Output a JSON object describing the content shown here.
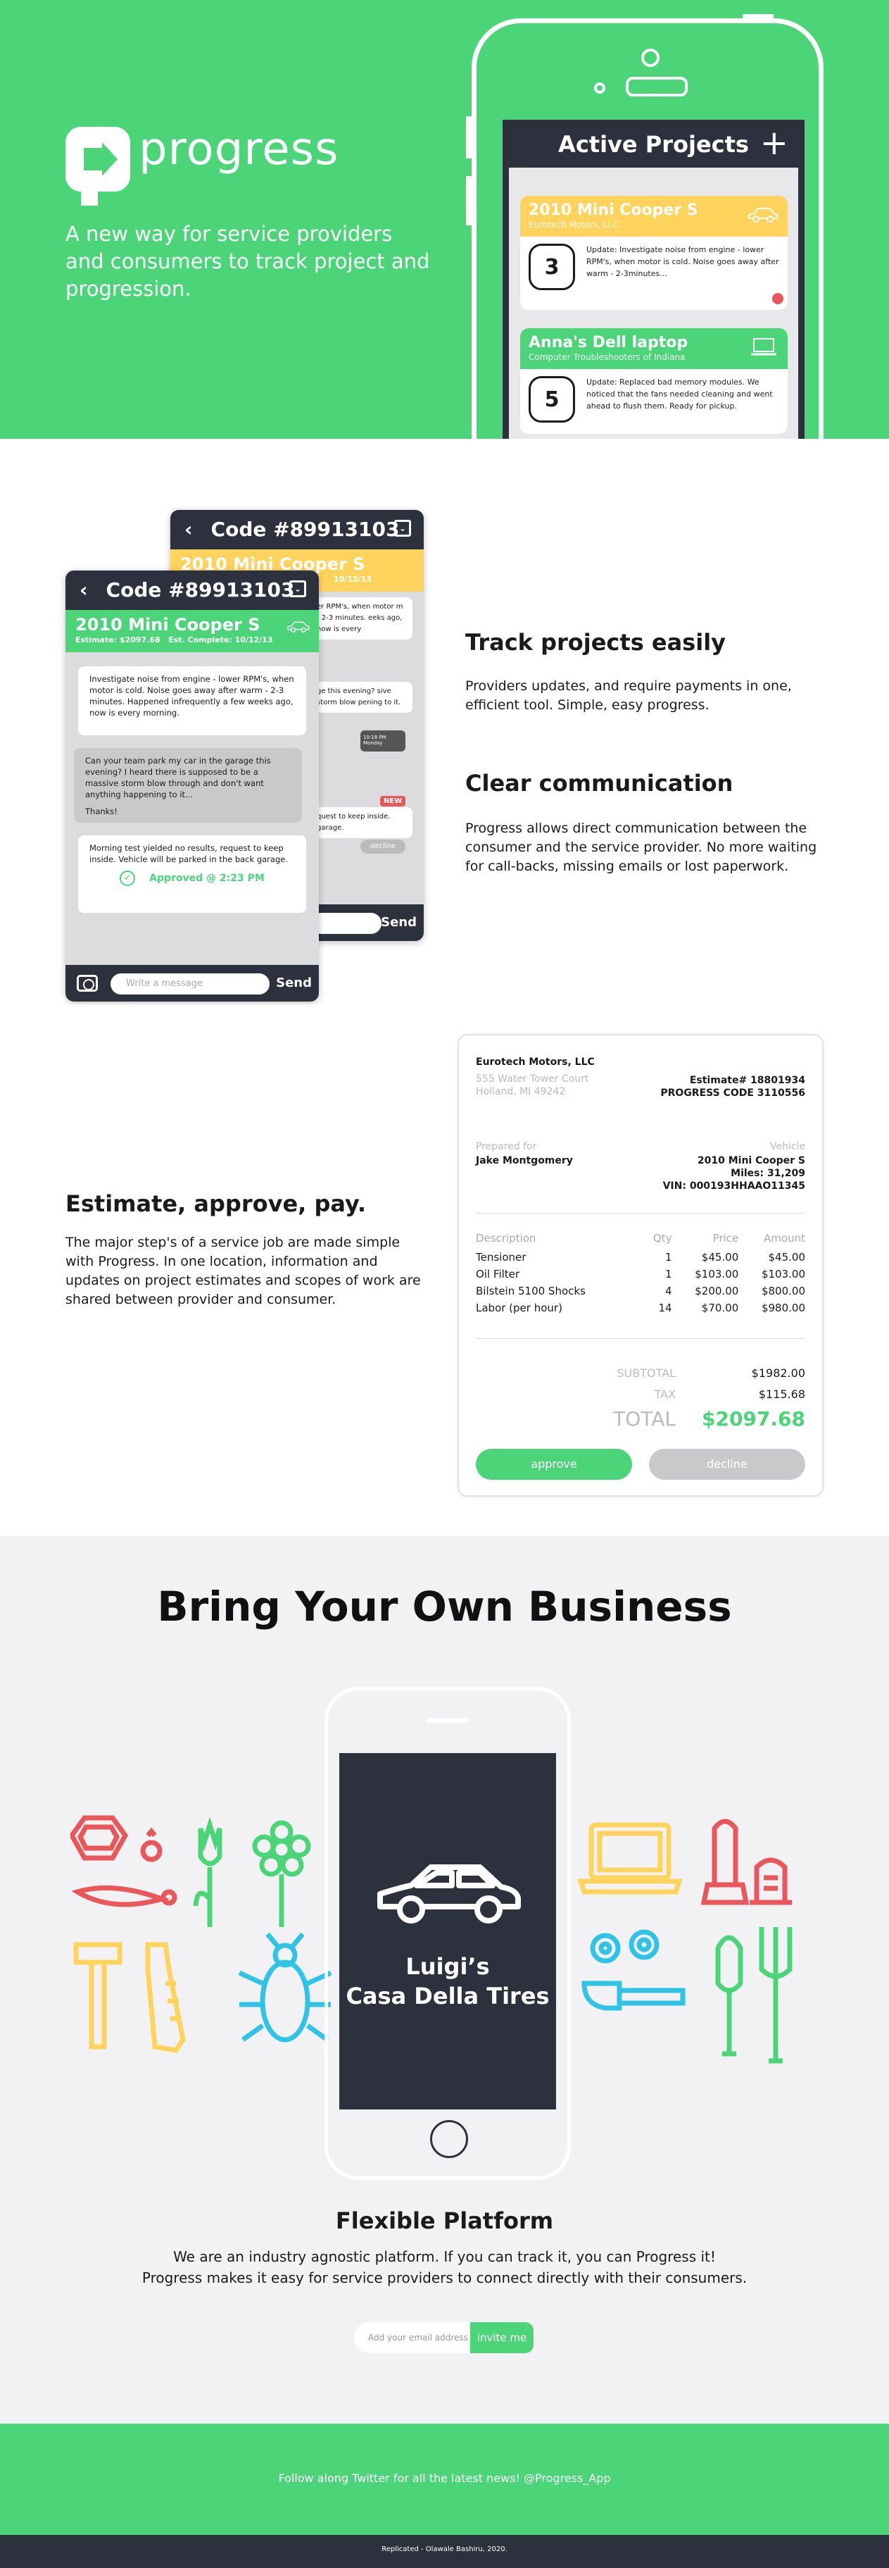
{
  "colors": {
    "green": "#4cd479",
    "yellow": "#ffd35c",
    "dark": "#2d313d",
    "red": "#e9575a",
    "blue": "#2fc3e6"
  },
  "hero": {
    "brand": "progress",
    "tagline": "A new way for service providers and consumers to track project and progression.",
    "screen_title": "Active Projects",
    "plus": "+",
    "projects": [
      {
        "title": "2010 Mini Cooper S",
        "subtitle": "Eurotech Motors, LLC",
        "count": "3",
        "update": "Update: Investigate noise from engine - lower RPM's, when motor is cold. Noise goes away after warm - 2-3minutes..."
      },
      {
        "title": "Anna's Dell laptop",
        "subtitle": "Computer Troubleshooters of Indiana",
        "count": "5",
        "update": "Update: Replaced bad memory modules. We noticed that the fans needed cleaning and went ahead to flush them. Ready for pickup."
      }
    ]
  },
  "chat": {
    "code": "Code #89913103",
    "vehicle": "2010 Mini Cooper S",
    "estimate": "Estimate: $2097.68",
    "complete": "Est. Complete: 10/12/13",
    "back_date": "10/12/13",
    "msg1": "Investigate noise from engine - lower RPM's, when motor is cold. Noise goes away after warm - 2-3 minutes. Happened infrequently a few weeks ago, now is every morning.",
    "msg2": "Can your team park my car in the garage this evening? I heard there is supposed to be a massive storm blow through and don't want anything happening to it...",
    "msg2b": "Thanks!",
    "msg3": "Morning test yielded no results, request to keep inside. Vehicle will be parked in the back garage.",
    "approved": "Approved @ 2:23 PM",
    "placeholder": "Write a message",
    "send": "Send",
    "new_badge": "NEW",
    "decline": "decline",
    "back_frag1": "er RPM's, when motor m - 2-3 minutes. eeks ago, now is every",
    "back_frag2": "ge this evening? sive storm blow pening to it.",
    "back_frag3": "quest to keep inside. garage.",
    "reminder": "10:18 PM Monday"
  },
  "features": [
    {
      "title": "Track projects easily",
      "text": "Providers updates, and require payments in one, efficient tool. Simple, easy progress."
    },
    {
      "title": "Clear communication",
      "text": "Progress allows direct communication between the consumer and the service provider. No more waiting for call-backs, missing emails or lost paperwork."
    }
  ],
  "estimate": {
    "title": "Estimate, approve, pay.",
    "text": "The major step's of a service job are made simple with Progress. In one location, information and updates on project estimates and scopes of work are shared between provider and consumer.",
    "company": "Eurotech Motors, LLC",
    "addr1": "555 Water Tower Court",
    "addr2": "Holland, MI 49242",
    "est_no": "Estimate# 18801934",
    "code": "PROGRESS CODE 3110556",
    "prepared_label": "Prepared for",
    "prepared_for": "Jake Montgomery",
    "vehicle_label": "Vehicle",
    "vehicle": "2010 Mini Cooper S",
    "miles": "Miles: 31,209",
    "vin": "VIN: 000193HHAAO11345",
    "headers": [
      "Description",
      "Qty",
      "Price",
      "Amount"
    ],
    "rows": [
      [
        "Tensioner",
        "1",
        "$45.00",
        "$45.00"
      ],
      [
        "Oil Filter",
        "1",
        "$103.00",
        "$103.00"
      ],
      [
        "Bilstein 5100 Shocks",
        "4",
        "$200.00",
        "$800.00"
      ],
      [
        "Labor (per hour)",
        "14",
        "$70.00",
        "$980.00"
      ]
    ],
    "subtotal_label": "SUBTOTAL",
    "subtotal": "$1982.00",
    "tax_label": "TAX",
    "tax": "$115.68",
    "total_label": "TOTAL",
    "total": "$2097.68",
    "approve": "approve",
    "decline": "decline"
  },
  "byob": {
    "title": "Bring Your Own Business",
    "luigi1": "Luigi’s",
    "luigi2": "Casa Della Tires",
    "flex_title": "Flexible Platform",
    "flex1": "We are an industry agnostic platform. If you can track it, you can Progress it!",
    "flex2": "Progress makes it easy for service providers to connect directly with their consumers.",
    "email_placeholder": "Add your email address",
    "invite": "invite me"
  },
  "footer": {
    "twitter": "Follow along Twitter for all the latest news! @Progress_App",
    "credit": "Replicated - Olawale Bashiru, 2020."
  }
}
